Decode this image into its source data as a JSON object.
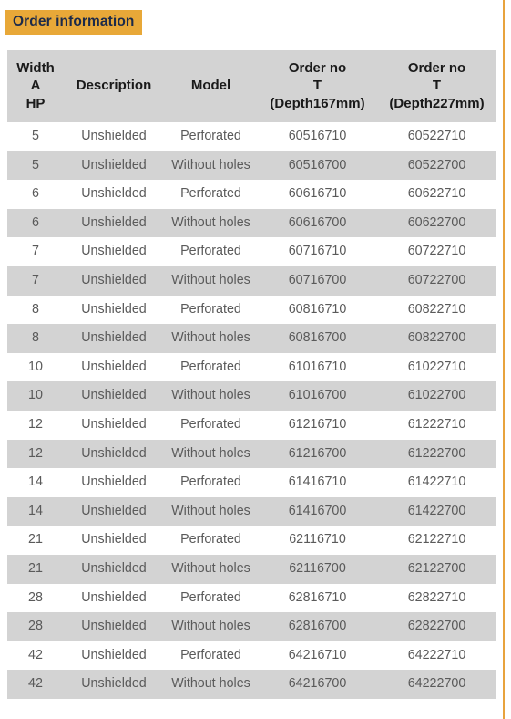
{
  "theme": {
    "badge_bg": "#e8a838",
    "badge_text": "#1b2a4a",
    "header_bg": "#d3d3d3",
    "row_shaded_bg": "#d3d3d3",
    "row_plain_bg": "#ffffff",
    "body_text": "#5a5a5a",
    "header_text": "#1a1a1a",
    "rule_color": "#e8a33d"
  },
  "title": "Order information",
  "table": {
    "headers": [
      {
        "lines": [
          "Width",
          "A",
          "HP"
        ]
      },
      {
        "lines": [
          "Description"
        ]
      },
      {
        "lines": [
          "Model"
        ]
      },
      {
        "lines": [
          "Order no",
          "T",
          "(Depth167mm)"
        ]
      },
      {
        "lines": [
          "Order no",
          "T",
          "(Depth227mm)"
        ]
      }
    ],
    "rows": [
      {
        "width": "5",
        "description": "Unshielded",
        "model": "Perforated",
        "order_no_167": "60516710",
        "order_no_227": "60522710",
        "shaded": false
      },
      {
        "width": "5",
        "description": "Unshielded",
        "model": "Without holes",
        "order_no_167": "60516700",
        "order_no_227": "60522700",
        "shaded": true
      },
      {
        "width": "6",
        "description": "Unshielded",
        "model": "Perforated",
        "order_no_167": "60616710",
        "order_no_227": "60622710",
        "shaded": false
      },
      {
        "width": "6",
        "description": "Unshielded",
        "model": "Without holes",
        "order_no_167": "60616700",
        "order_no_227": "60622700",
        "shaded": true
      },
      {
        "width": "7",
        "description": "Unshielded",
        "model": "Perforated",
        "order_no_167": "60716710",
        "order_no_227": "60722710",
        "shaded": false
      },
      {
        "width": "7",
        "description": "Unshielded",
        "model": "Without holes",
        "order_no_167": "60716700",
        "order_no_227": "60722700",
        "shaded": true
      },
      {
        "width": "8",
        "description": "Unshielded",
        "model": "Perforated",
        "order_no_167": "60816710",
        "order_no_227": "60822710",
        "shaded": false
      },
      {
        "width": "8",
        "description": "Unshielded",
        "model": "Without holes",
        "order_no_167": "60816700",
        "order_no_227": "60822700",
        "shaded": true
      },
      {
        "width": "10",
        "description": "Unshielded",
        "model": "Perforated",
        "order_no_167": "61016710",
        "order_no_227": "61022710",
        "shaded": false
      },
      {
        "width": "10",
        "description": "Unshielded",
        "model": "Without holes",
        "order_no_167": "61016700",
        "order_no_227": "61022700",
        "shaded": true
      },
      {
        "width": "12",
        "description": "Unshielded",
        "model": "Perforated",
        "order_no_167": "61216710",
        "order_no_227": "61222710",
        "shaded": false
      },
      {
        "width": "12",
        "description": "Unshielded",
        "model": "Without holes",
        "order_no_167": "61216700",
        "order_no_227": "61222700",
        "shaded": true
      },
      {
        "width": "14",
        "description": "Unshielded",
        "model": "Perforated",
        "order_no_167": "61416710",
        "order_no_227": "61422710",
        "shaded": false
      },
      {
        "width": "14",
        "description": "Unshielded",
        "model": "Without holes",
        "order_no_167": "61416700",
        "order_no_227": "61422700",
        "shaded": true
      },
      {
        "width": "21",
        "description": "Unshielded",
        "model": "Perforated",
        "order_no_167": "62116710",
        "order_no_227": "62122710",
        "shaded": false
      },
      {
        "width": "21",
        "description": "Unshielded",
        "model": "Without holes",
        "order_no_167": "62116700",
        "order_no_227": "62122700",
        "shaded": true
      },
      {
        "width": "28",
        "description": "Unshielded",
        "model": "Perforated",
        "order_no_167": "62816710",
        "order_no_227": "62822710",
        "shaded": false
      },
      {
        "width": "28",
        "description": "Unshielded",
        "model": "Without holes",
        "order_no_167": "62816700",
        "order_no_227": "62822700",
        "shaded": true
      },
      {
        "width": "42",
        "description": "Unshielded",
        "model": "Perforated",
        "order_no_167": "64216710",
        "order_no_227": "64222710",
        "shaded": false
      },
      {
        "width": "42",
        "description": "Unshielded",
        "model": "Without holes",
        "order_no_167": "64216700",
        "order_no_227": "64222700",
        "shaded": true
      }
    ]
  }
}
